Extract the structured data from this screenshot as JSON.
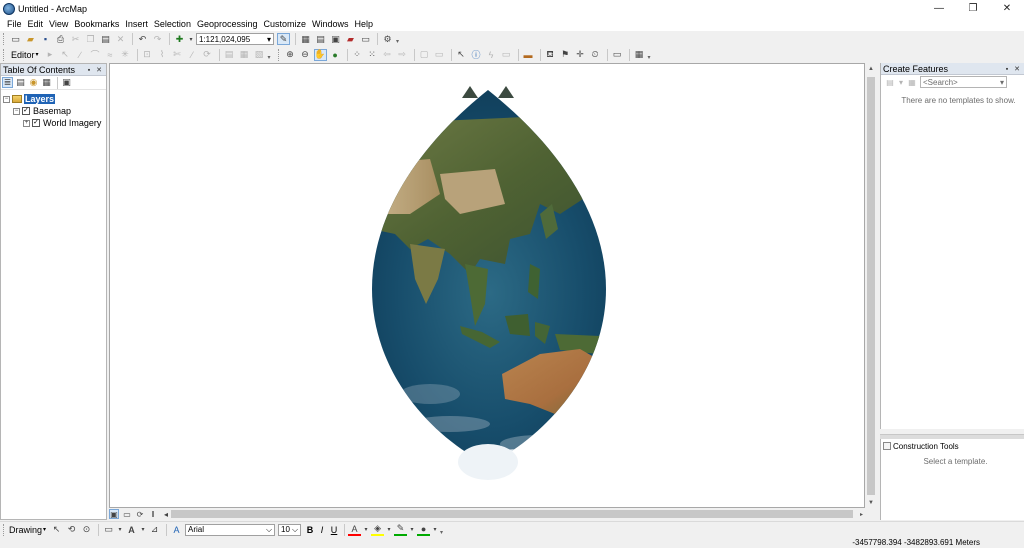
{
  "window": {
    "title": "Untitled - ArcMap",
    "controls": {
      "minimize": "—",
      "maximize": "❐",
      "close": "✕"
    }
  },
  "menubar": {
    "items": [
      "File",
      "Edit",
      "View",
      "Bookmarks",
      "Insert",
      "Selection",
      "Geoprocessing",
      "Customize",
      "Windows",
      "Help"
    ]
  },
  "standard_toolbar": {
    "scale_value": "1:121,024,095",
    "scale_caret": "▾"
  },
  "editor_toolbar": {
    "label": "Editor",
    "caret": "▾"
  },
  "toc": {
    "title": "Table Of Contents",
    "pin": "▪ ✕",
    "tree": {
      "root_label": "Layers",
      "group_label": "Basemap",
      "layer_label": "World Imagery",
      "collapse_symbol": "−",
      "expand_symbol": "+",
      "checked_symbol": "✓"
    }
  },
  "map": {
    "projection_shape": "lens (interrupted gore)",
    "content": "World Imagery basemap centered on Asia–Australia"
  },
  "create_features": {
    "title": "Create Features",
    "pin": "▪ ✕",
    "search_placeholder": "<Search>",
    "search_caret": "▾",
    "empty_message": "There are no templates to show."
  },
  "construction_tools": {
    "title": "Construction Tools",
    "empty_message": "Select a template."
  },
  "drawing_toolbar": {
    "label": "Drawing",
    "caret": "▾",
    "font_name": "Arial",
    "font_size": "10",
    "bold": "B",
    "italic": "I",
    "underline": "U",
    "text_color_label": "A",
    "font_color_accent": "#ff0000",
    "fill_color_accent": "#ffff00",
    "line_color_accent": "#00aa00"
  },
  "statusbar": {
    "coordinates": "-3457798.394  -3482893.691 Meters"
  }
}
